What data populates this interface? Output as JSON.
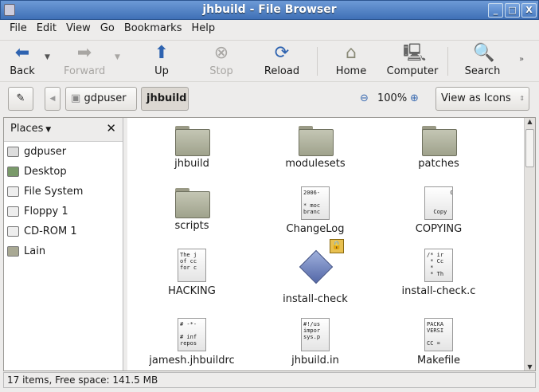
{
  "window": {
    "title": "jhbuild - File Browser",
    "minimize": "_",
    "maximize": "□",
    "close": "X"
  },
  "menu": [
    "File",
    "Edit",
    "View",
    "Go",
    "Bookmarks",
    "Help"
  ],
  "toolbar": {
    "back": "Back",
    "forward": "Forward",
    "up": "Up",
    "stop": "Stop",
    "reload": "Reload",
    "home": "Home",
    "computer": "Computer",
    "search": "Search"
  },
  "location": {
    "path": [
      "gdpuser",
      "jhbuild"
    ],
    "zoom": "100%",
    "view_mode": "View as Icons"
  },
  "sidebar": {
    "title": "Places",
    "items": [
      "gdpuser",
      "Desktop",
      "File System",
      "Floppy 1",
      "CD-ROM 1",
      "Lain"
    ]
  },
  "files": [
    {
      "name": "jhbuild",
      "type": "folder"
    },
    {
      "name": "modulesets",
      "type": "folder"
    },
    {
      "name": "patches",
      "type": "folder"
    },
    {
      "name": "scripts",
      "type": "folder"
    },
    {
      "name": "ChangeLog",
      "type": "text",
      "preview": "2006-\n\n* moc\nbranc"
    },
    {
      "name": "COPYING",
      "type": "text",
      "preview": "       G\n\n\n  Copy"
    },
    {
      "name": "HACKING",
      "type": "text",
      "preview": "The j\nof cc\nfor c"
    },
    {
      "name": "install-check",
      "type": "exec"
    },
    {
      "name": "install-check.c",
      "type": "text",
      "preview": "/* ir\n * Cc\n *\n * Th"
    },
    {
      "name": "jamesh.jhbuildrc",
      "type": "text",
      "preview": "# -*-\n\n# inf\nrepos"
    },
    {
      "name": "jhbuild.in",
      "type": "text",
      "preview": "#!/us\nimpor\nsys.p"
    },
    {
      "name": "Makefile",
      "type": "text",
      "preview": "PACKA\nVERSI\n\nCC ="
    }
  ],
  "status": "17 items, Free space: 141.5 MB"
}
